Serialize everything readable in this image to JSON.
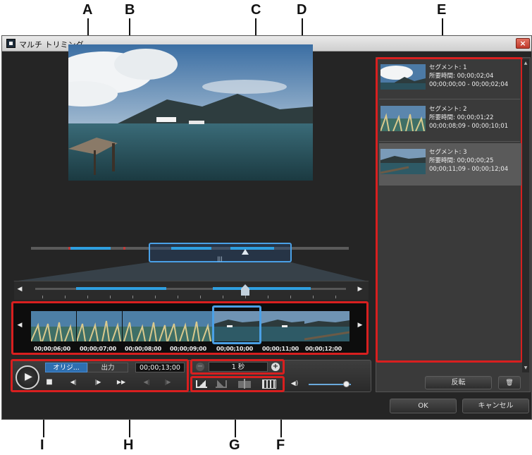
{
  "callouts": {
    "A": "A",
    "B": "B",
    "C": "C",
    "D": "D",
    "E": "E",
    "F": "F",
    "G": "G",
    "H": "H",
    "I": "I"
  },
  "window": {
    "title": "マルチ トリミング",
    "close_glyph": "×"
  },
  "overview_handle_glyph": "|||",
  "nav": {
    "left_arrow": "◀",
    "right_arrow": "▶"
  },
  "filmstrip": {
    "timecodes": [
      "00;00;06;00",
      "00;00;07;00",
      "00;00;08;00",
      "00;00;09;00",
      "00;00;10;00",
      "00;00;11;00",
      "00;00;12;00"
    ]
  },
  "playback": {
    "play_glyph": "▶",
    "original_tab": "オリジ...",
    "output_tab": "出力",
    "current_time": "00;00;13;00",
    "stop_glyph": "■",
    "prev_frame_glyph": "◀|",
    "next_frame_glyph": "|▶",
    "fast_forward_glyph": "▶▶",
    "mark_in_glyph": "◀|",
    "mark_out_glyph": "|▶"
  },
  "zoom": {
    "label": "1 秒",
    "zoom_out_glyph": "−",
    "zoom_in_glyph": "+"
  },
  "volume": {
    "icon_glyph": "◀)",
    "level": 0.88
  },
  "segments": [
    {
      "name": "セグメント: 1",
      "duration": "所要時間: 00;00;02;04",
      "range": "00;00;00;00 - 00;00;02;04",
      "selected": false
    },
    {
      "name": "セグメント: 2",
      "duration": "所要時間: 00;00;01;22",
      "range": "00;00;08;09 - 00;00;10;01",
      "selected": false
    },
    {
      "name": "セグメント: 3",
      "duration": "所要時間: 00;00;00;25",
      "range": "00;00;11;09 - 00;00;12;04",
      "selected": true
    }
  ],
  "segment_panel": {
    "invert_label": "反転",
    "delete_glyph": "🗑",
    "scroll_up_glyph": "▲",
    "scroll_down_glyph": "▼"
  },
  "dialog": {
    "ok_label": "OK",
    "cancel_label": "キャンセル"
  },
  "colors": {
    "highlight_box": "#d81f1f",
    "segment_blue": "#2f9fe0",
    "focus_blue": "#4aa0e6"
  }
}
